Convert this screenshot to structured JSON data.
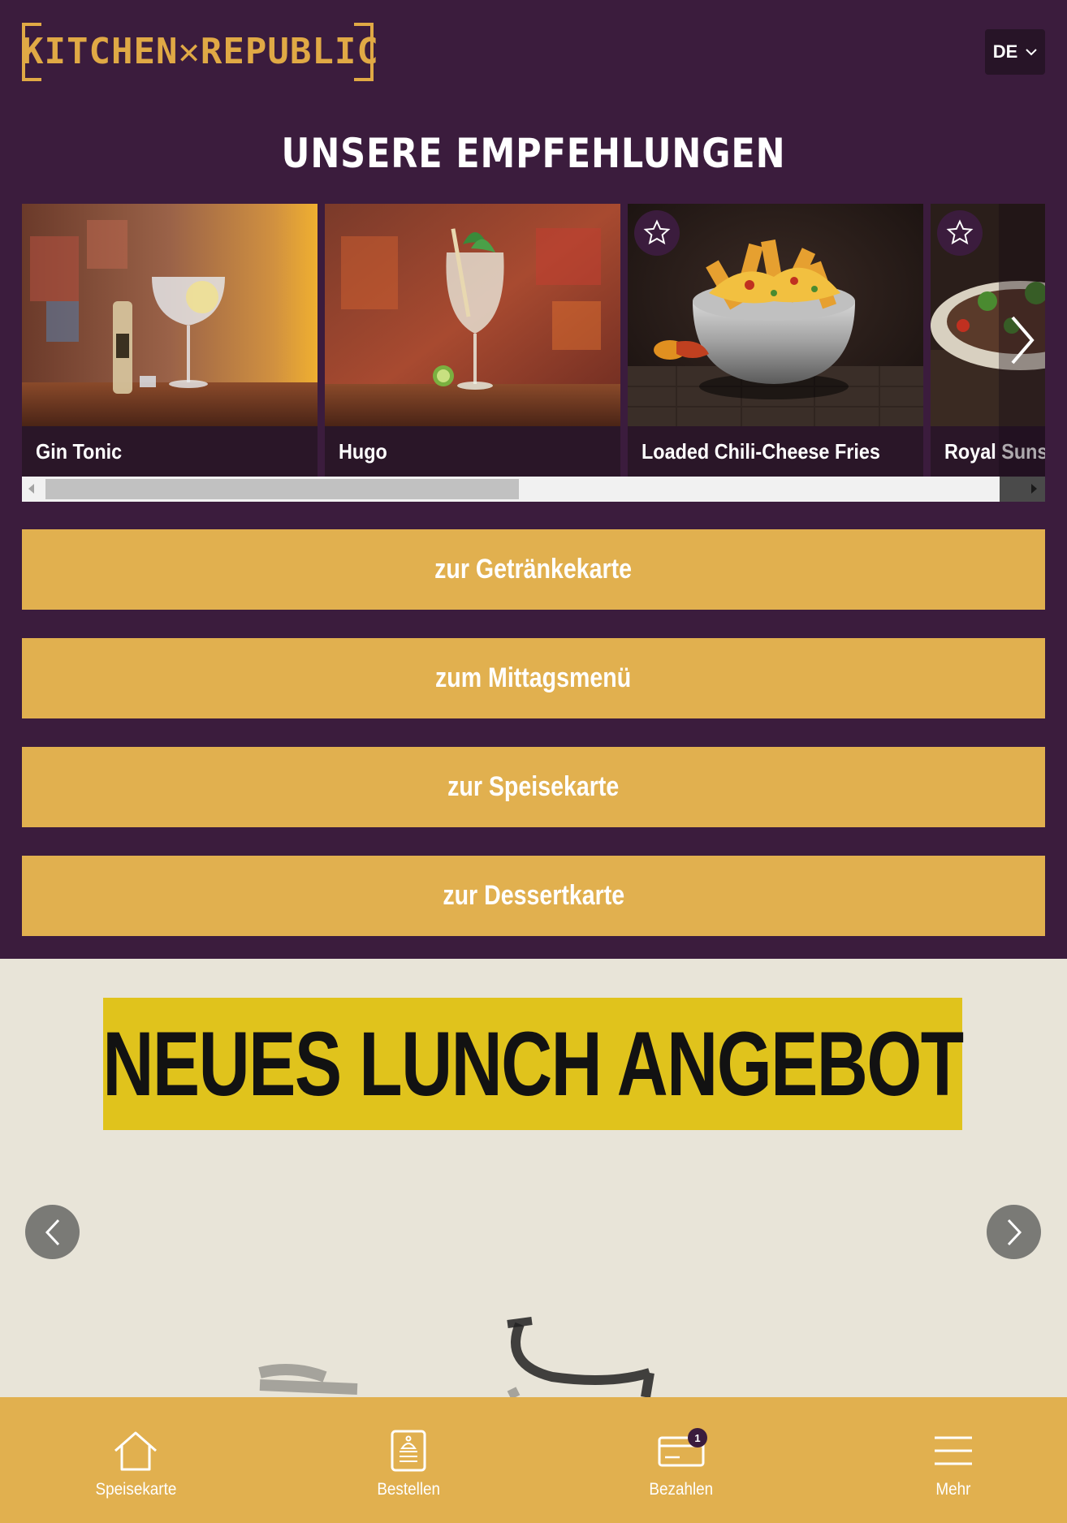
{
  "brand": {
    "logo_text": "KITCHEN✕REPUBLIC",
    "primary_color": "#3b1c3d",
    "accent_color": "#e1b04f"
  },
  "language": {
    "selected": "DE"
  },
  "recommendations": {
    "title": "UNSERE EMPFEHLUNGEN",
    "items": [
      {
        "name": "Gin Tonic",
        "favorite_icon": false
      },
      {
        "name": "Hugo",
        "favorite_icon": false
      },
      {
        "name": "Loaded Chili-Cheese Fries",
        "favorite_icon": true
      },
      {
        "name": "Royal Suns",
        "favorite_icon": true
      }
    ]
  },
  "menu_buttons": [
    "zur Getränkekarte",
    "zum Mittagsmenü",
    "zur Speisekarte",
    "zur Dessertkarte"
  ],
  "promo": {
    "banner_text": "NEUES LUNCH ANGEBOT"
  },
  "bottom_nav": [
    {
      "label": "Speisekarte",
      "icon": "home-icon"
    },
    {
      "label": "Bestellen",
      "icon": "order-icon"
    },
    {
      "label": "Bezahlen",
      "icon": "payment-card-icon",
      "badge": "1"
    },
    {
      "label": "Mehr",
      "icon": "menu-icon"
    }
  ]
}
